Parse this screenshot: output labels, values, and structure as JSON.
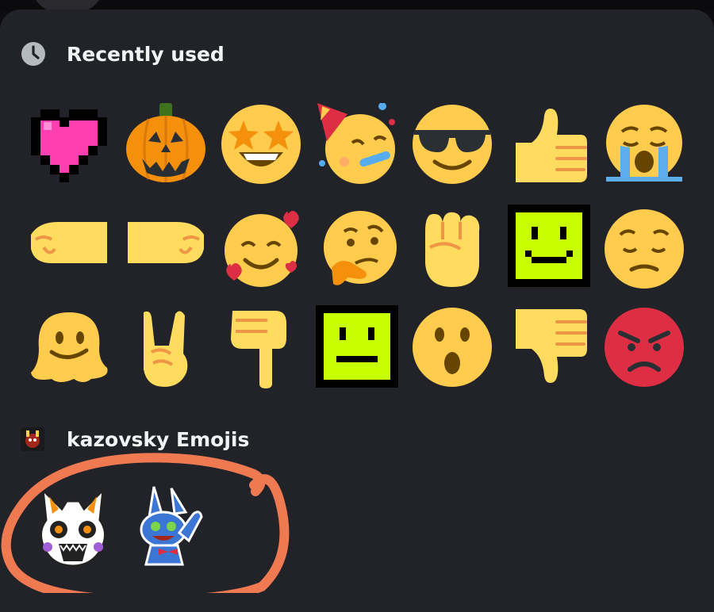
{
  "recently_used": {
    "title": "Recently used",
    "icon": "clock-icon",
    "emojis": [
      "pixel-heart",
      "jack-o-lantern",
      "star-struck",
      "partying-face",
      "sunglasses-face",
      "thumbs-up",
      "loudly-crying-face",
      "left-facing-fist",
      "right-facing-fist",
      "smiling-face-with-hearts",
      "thinking-face",
      "raised-fist",
      "pixel-smile-green",
      "pensive-face",
      "melting-face",
      "sign-of-the-horns",
      "backhand-index-pointing-down",
      "pixel-neutral-green",
      "hushed-face",
      "thumbs-down",
      "pouting-face"
    ]
  },
  "server_section": {
    "title": "kazovsky Emojis",
    "icon": "server-icon",
    "emojis": [
      "lolbit-emoji",
      "toy-bonnie-emoji"
    ]
  },
  "colors": {
    "panel_bg": "#222329",
    "text": "#f2f3f5",
    "annotation": "#ef7a52"
  }
}
